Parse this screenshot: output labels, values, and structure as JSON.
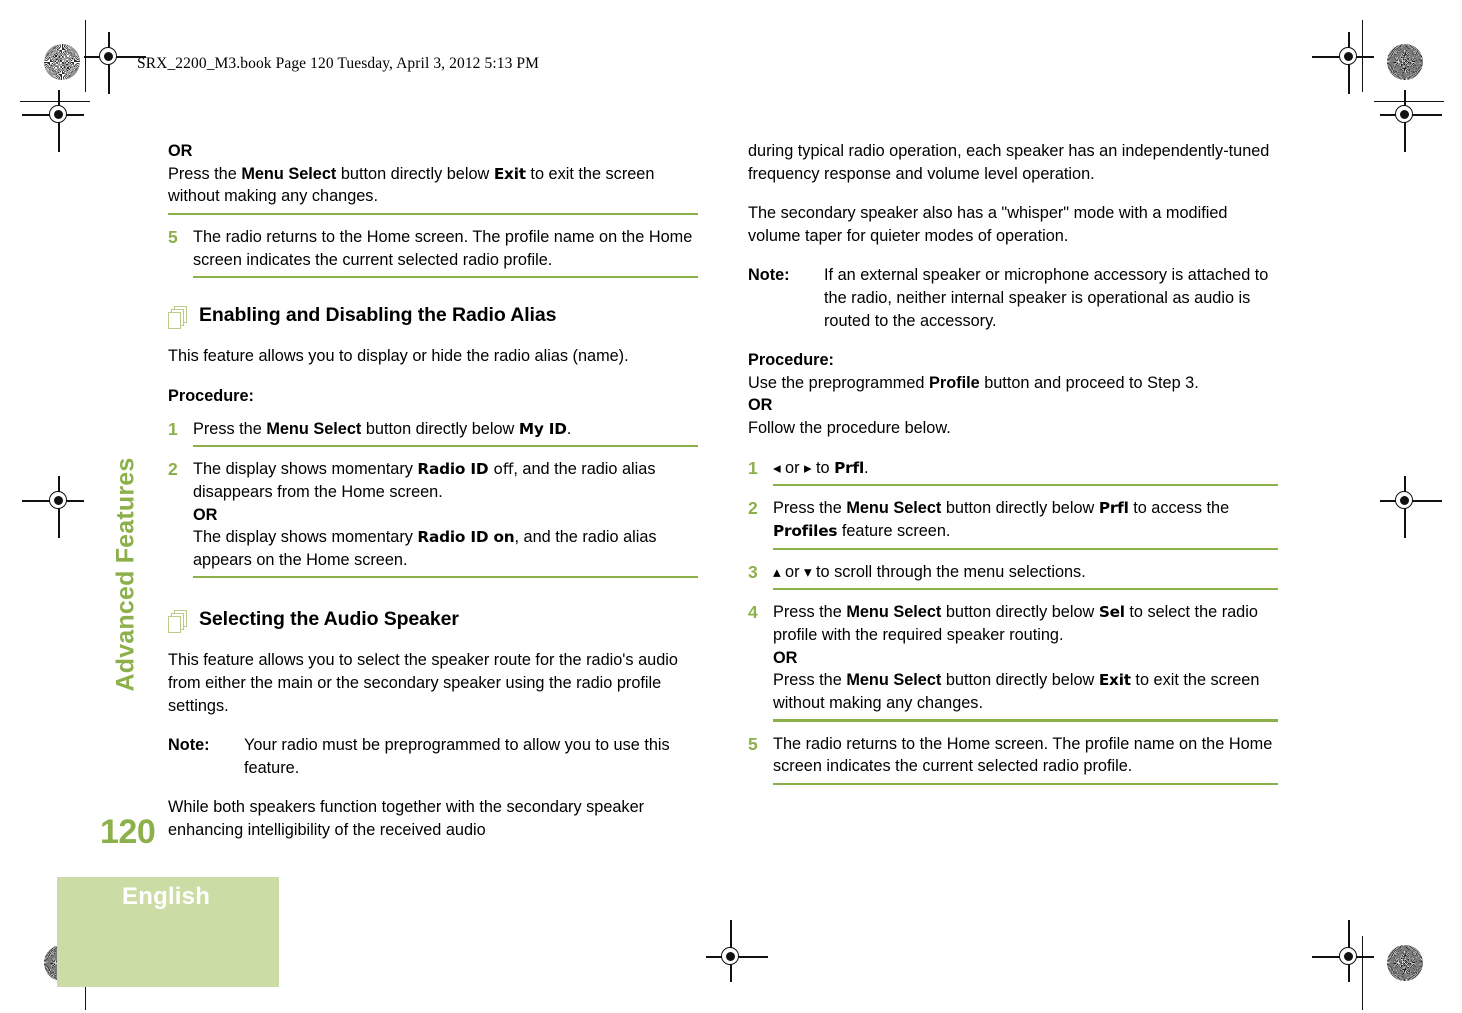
{
  "book_header": "SRX_2200_M3.book  Page 120  Tuesday, April 3, 2012  5:13 PM",
  "chapter": {
    "tab_label": "Advanced Features",
    "page_number": "120",
    "language": "English"
  },
  "colors": {
    "accent_green": "#8CB04A",
    "box_green": "#CBDDA4",
    "icon_green": "#B6CE8A"
  },
  "icons": {
    "section": "stacked-pages-icon",
    "nav_left": "◂",
    "nav_right": "▸",
    "nav_up": "▴",
    "nav_down": "▾"
  },
  "left_column": {
    "or_label": "OR",
    "or_text_a": "Press the ",
    "menu_select": "Menu Select",
    "or_text_b": " button directly below ",
    "exit_key": "Exit",
    "or_text_c": " to exit the screen without making any changes.",
    "step5_num": "5",
    "step5_text": "The radio returns to the Home screen. The profile name on the Home screen indicates the current selected radio profile.",
    "section1": {
      "title": "Enabling and Disabling the Radio Alias",
      "intro": "This feature allows you to display or hide the radio alias (name).",
      "procedure_label": "Procedure:",
      "step1_num": "1",
      "step1_a": "Press the ",
      "step1_b": " button directly below ",
      "step1_key": "My ID",
      "step1_c": ".",
      "step2_num": "2",
      "step2_a": "The display shows momentary ",
      "step2_key_bold": "Radio ID ",
      "step2_key_light": "off",
      "step2_b": ", and the radio alias disappears from the Home screen.",
      "step2_or": "OR",
      "step2_c": "The display shows momentary ",
      "step2_key2": "Radio ID on",
      "step2_d": ", and the radio alias appears on the Home screen."
    },
    "section2": {
      "title": "Selecting the Audio Speaker",
      "intro": "This feature allows you to select the speaker route for the radio's audio from either the main or the secondary speaker using the radio profile settings.",
      "note_label": "Note:",
      "note_text": "Your radio must be preprogrammed to allow you to use this feature.",
      "trailing": "While both speakers function together with the secondary speaker enhancing intelligibility of the received audio"
    }
  },
  "right_column": {
    "para1": "during typical radio operation, each speaker has an independently-tuned frequency response and volume level operation.",
    "para2": "The secondary speaker also has a \"whisper\" mode with a modified volume taper for quieter modes of operation.",
    "note_label": "Note:",
    "note_text": "If an external speaker or microphone accessory is attached to the radio, neither internal speaker is operational as audio is routed to the accessory.",
    "procedure_label": "Procedure:",
    "proc_a": "Use the preprogrammed ",
    "proc_key": "Profile",
    "proc_b": " button and proceed to Step 3.",
    "or_label": "OR",
    "proc_c": "Follow the procedure below.",
    "step1_num": "1",
    "step1_or": " or ",
    "step1_to": " to ",
    "step1_key": "Prfl",
    "step1_end": ".",
    "step2_num": "2",
    "step2_a": "Press the ",
    "menu_select": "Menu Select",
    "step2_b": " button directly below ",
    "step2_key": "Prfl",
    "step2_c": " to access the ",
    "step2_key2": "Profiles",
    "step2_d": " feature screen.",
    "step3_num": "3",
    "step3_or": " or ",
    "step3_text": " to scroll through the menu selections.",
    "step4_num": "4",
    "step4_a": "Press the ",
    "step4_b": " button directly below ",
    "step4_key": "Sel",
    "step4_c": " to select the radio profile with the required speaker routing.",
    "step4_or": "OR",
    "step4_d": "Press the ",
    "step4_e": " button directly below ",
    "step4_key2": "Exit",
    "step4_f": " to exit the screen without making any changes.",
    "step5_num": "5",
    "step5_text": "The radio returns to the Home screen. The profile name on the Home screen indicates the current selected radio profile."
  }
}
